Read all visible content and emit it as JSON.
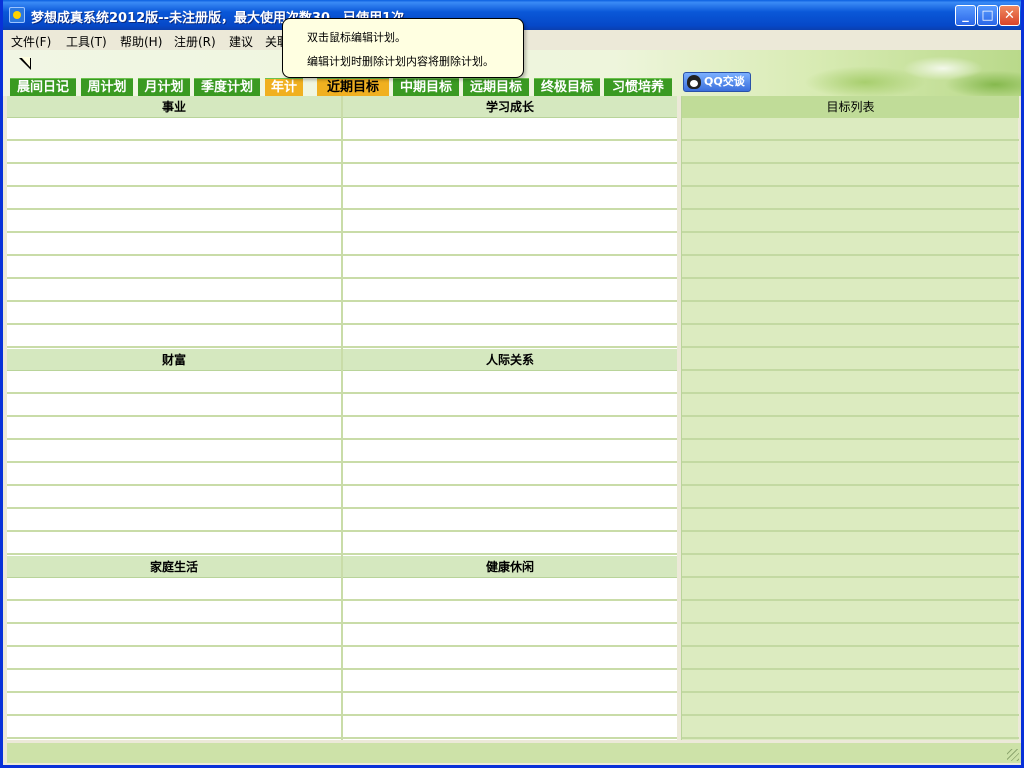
{
  "window": {
    "title": "梦想成真系统2012版--未注册版，最大使用次数30，已使用1次",
    "min_label": "_",
    "max_label": "□",
    "close_label": "✕"
  },
  "menu": {
    "items": [
      {
        "label": "文件(F)"
      },
      {
        "label": "工具(T)"
      },
      {
        "label": "帮助(H)"
      },
      {
        "label": "注册(R)"
      },
      {
        "label": "建议"
      },
      {
        "label": "关联"
      }
    ]
  },
  "tabs": [
    {
      "label": "晨间日记",
      "state": "normal"
    },
    {
      "label": "周计划",
      "state": "normal"
    },
    {
      "label": "月计划",
      "state": "normal"
    },
    {
      "label": "季度计划",
      "state": "normal"
    },
    {
      "label": "年计",
      "state": "active"
    },
    {
      "label": "近期目标",
      "state": "selected"
    },
    {
      "label": "中期目标",
      "state": "normal"
    },
    {
      "label": "远期目标",
      "state": "normal"
    },
    {
      "label": "终极目标",
      "state": "normal"
    },
    {
      "label": "习惯培养",
      "state": "normal"
    }
  ],
  "qq_button": {
    "label": "QQ交谈"
  },
  "sections": {
    "career": "事业",
    "study": "学习成长",
    "wealth": "财富",
    "relations": "人际关系",
    "family": "家庭生活",
    "health": "健康休闲"
  },
  "goal_list": {
    "header": "目标列表"
  },
  "tooltip": {
    "line1": "双击鼠标编辑计划。",
    "line2": "编辑计划时删除计划内容将删除计划。"
  },
  "colors": {
    "tab_green": "#3a9a22",
    "tab_active": "#f0b020",
    "section_header": "#d5e8bf",
    "right_panel": "#dcebc0",
    "title_bar": "#0a58d8"
  }
}
